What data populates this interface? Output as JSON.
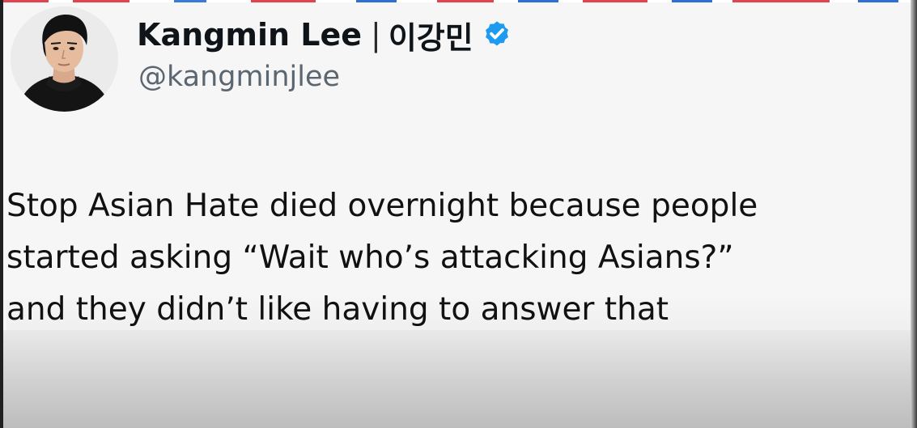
{
  "tweet": {
    "display_name": "Kangmin Lee",
    "separator": "|",
    "korean_name": "이강민",
    "handle": "@kangminjlee",
    "verified": true,
    "avatar_icon": "person-avatar",
    "text_lines": [
      "Stop Asian Hate died overnight because people",
      "started asking “Wait who’s attacking Asians?”",
      "and they didn’t like having to answer that"
    ]
  },
  "colors": {
    "verified_badge": "#1d9bf0",
    "name_text": "#0f1419",
    "handle_text": "#5b6670",
    "top_strip_accent": "#e0454f"
  },
  "icons": {
    "verified": "verified-badge-icon"
  }
}
